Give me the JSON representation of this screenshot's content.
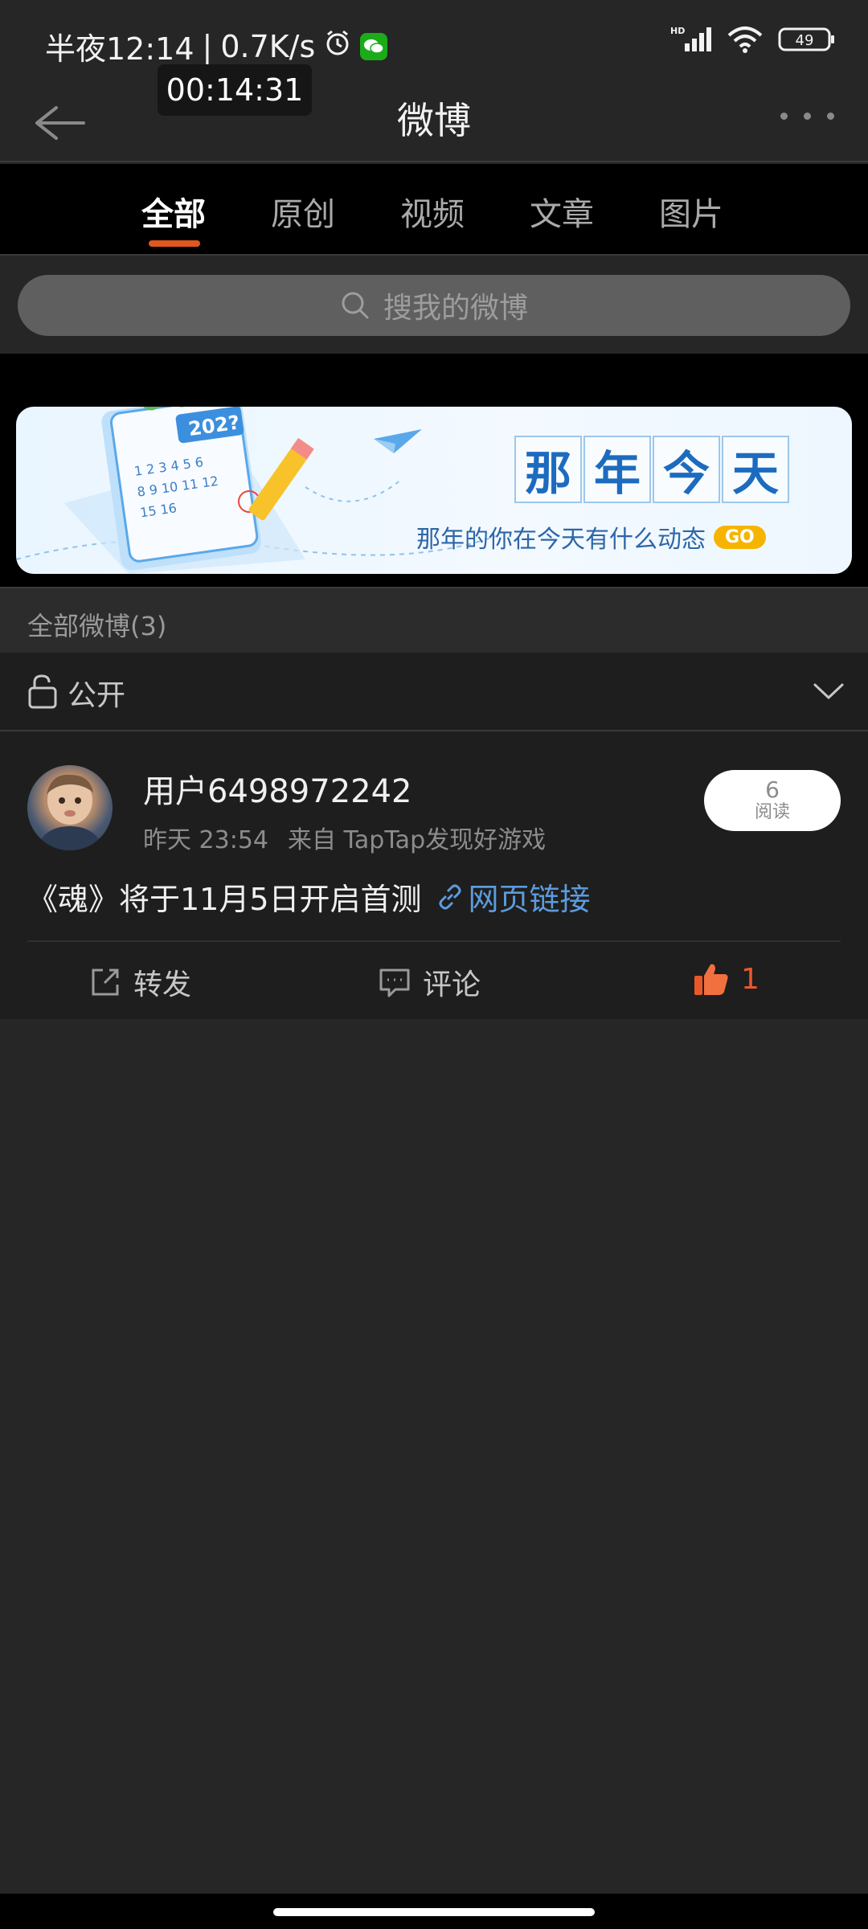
{
  "status_bar": {
    "time": "半夜12:14",
    "speed": "0.7K/s",
    "battery": "49",
    "timer": "00:14:31"
  },
  "header": {
    "title": "微博"
  },
  "tabs": [
    {
      "label": "全部",
      "active": true
    },
    {
      "label": "原创",
      "active": false
    },
    {
      "label": "视频",
      "active": false
    },
    {
      "label": "文章",
      "active": false
    },
    {
      "label": "图片",
      "active": false
    }
  ],
  "search": {
    "placeholder": "搜我的微博"
  },
  "banner": {
    "calendar_year": "202?",
    "title_chars": [
      "那",
      "年",
      "今",
      "天"
    ],
    "subtitle": "那年的你在今天有什么动态",
    "go_label": "GO"
  },
  "section": {
    "label": "全部微博(3)"
  },
  "filter": {
    "label": "公开"
  },
  "post": {
    "username": "用户6498972242",
    "time": "昨天 23:54",
    "source": "来自 TapTap发现好游戏",
    "read_count": "6",
    "read_label": "阅读",
    "content": "《魂》将于11月5日开启首测",
    "link_text": "网页链接",
    "repost_label": "转发",
    "comment_label": "评论",
    "like_count": "1"
  },
  "colors": {
    "accent": "#e0561f",
    "link": "#5c9bdd",
    "like": "#e8582a"
  }
}
